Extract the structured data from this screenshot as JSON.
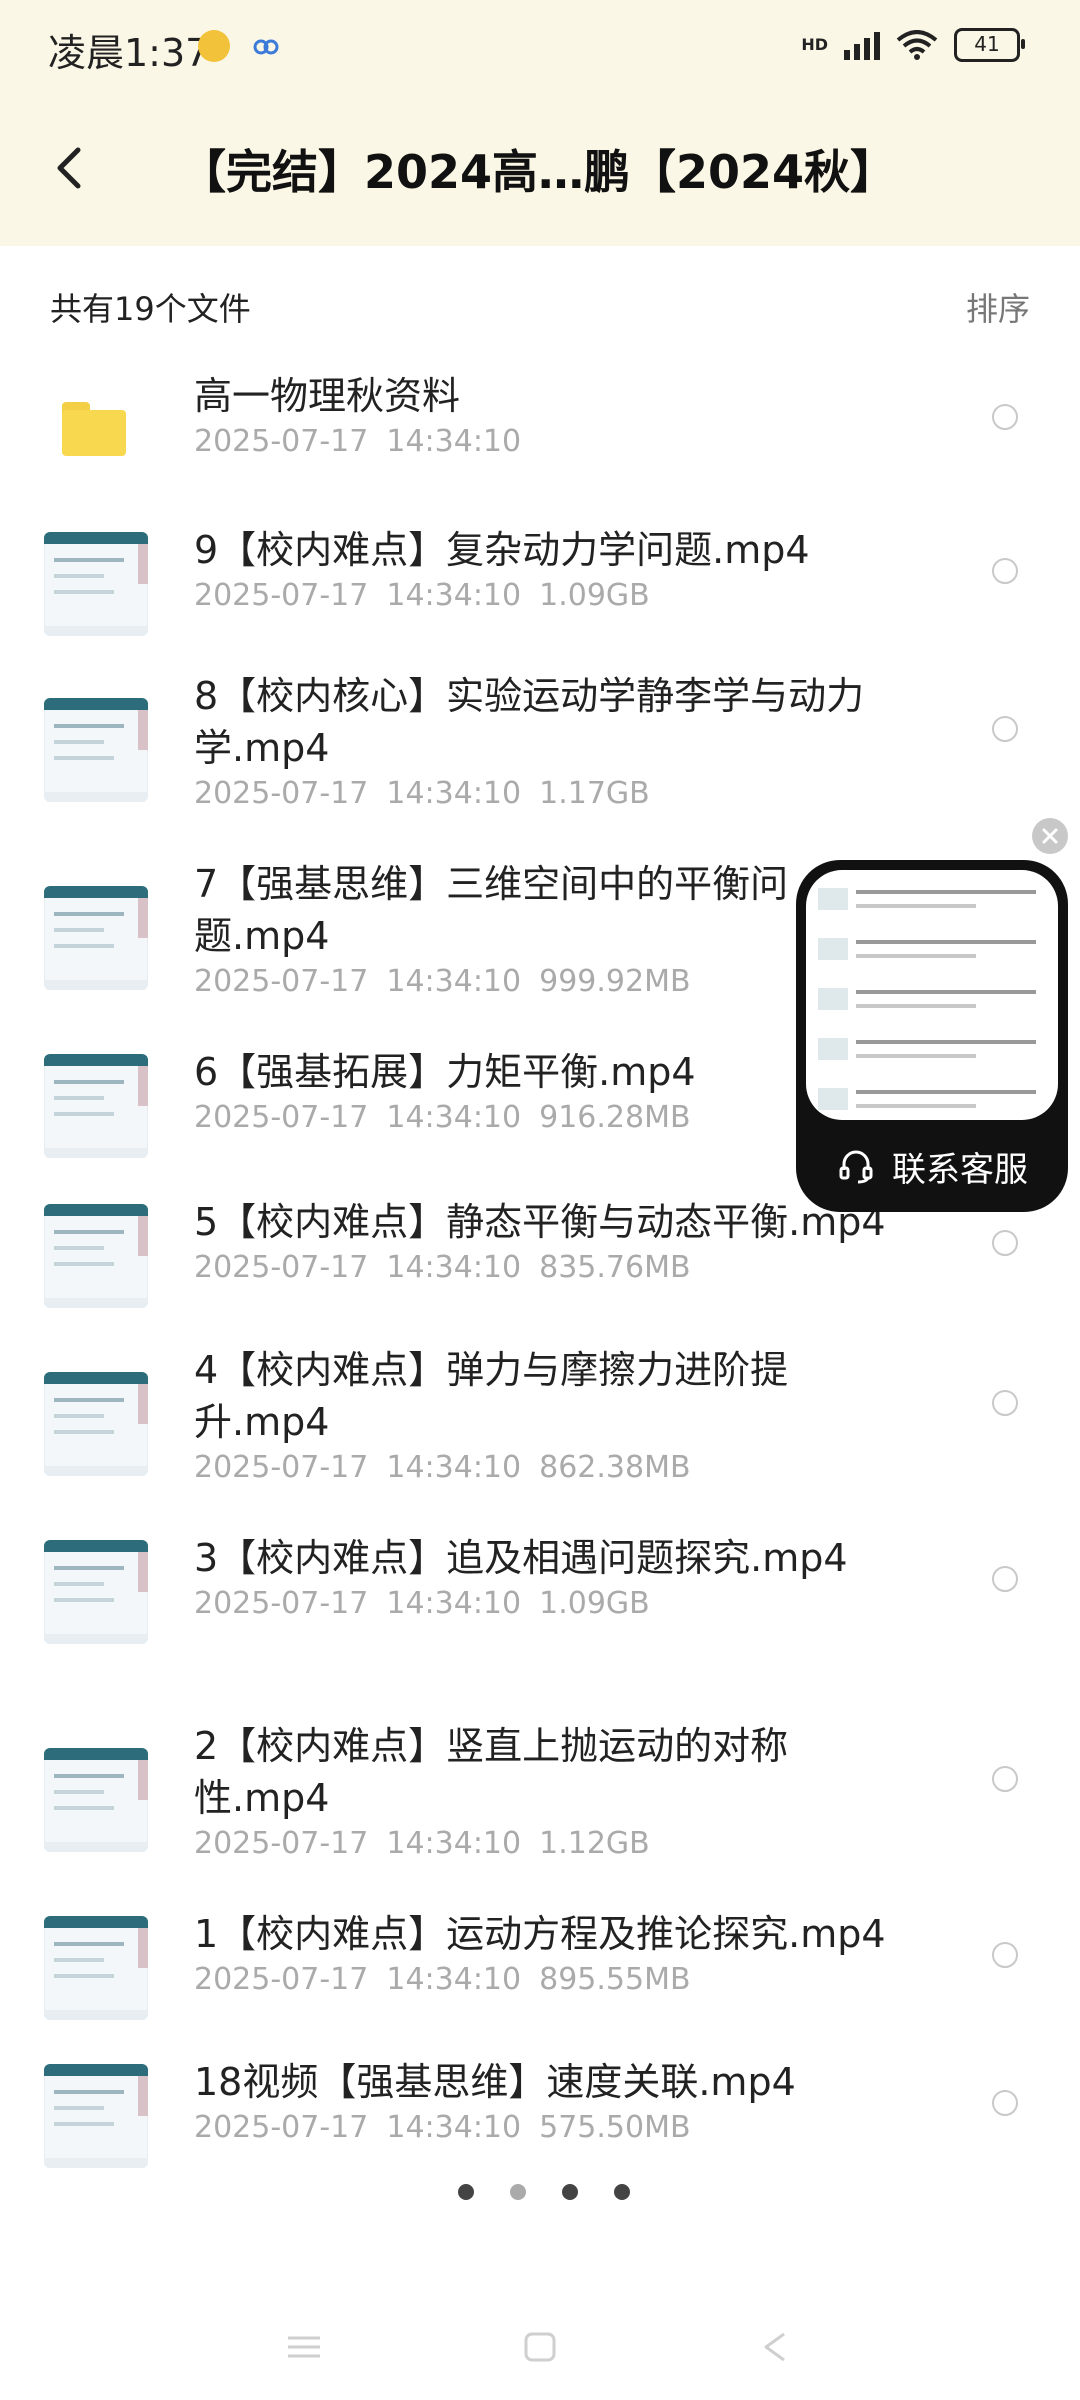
{
  "status": {
    "time": "凌晨1:37",
    "network": "HD",
    "battery": "41",
    "icons": [
      "app-badge-icon",
      "cloud-icon",
      "signal-icon",
      "wifi-icon",
      "battery-icon"
    ]
  },
  "header": {
    "title": "【完结】2024高…鹏【2024秋】",
    "back_icon": "chevron-left-icon"
  },
  "list_header": {
    "summary": "共有19个文件",
    "sort_label": "排序"
  },
  "files": [
    {
      "type": "folder",
      "name_line1": "高一物理秋资料",
      "name_line2": "",
      "date": "2025-07-17",
      "time": "14:34:10",
      "size": ""
    },
    {
      "type": "video",
      "name_line1": "9【校内难点】复杂动力学问题.mp4",
      "name_line2": "",
      "date": "2025-07-17",
      "time": "14:34:10",
      "size": "1.09GB"
    },
    {
      "type": "video",
      "name_line1": "8【校内核心】实验运动学静李学与动力",
      "name_line2": "学.mp4",
      "date": "2025-07-17",
      "time": "14:34:10",
      "size": "1.17GB"
    },
    {
      "type": "video",
      "name_line1": "7【强基思维】三维空间中的平衡问",
      "name_line2": "题.mp4",
      "date": "2025-07-17",
      "time": "14:34:10",
      "size": "999.92MB"
    },
    {
      "type": "video",
      "name_line1": "6【强基拓展】力矩平衡.mp4",
      "name_line2": "",
      "date": "2025-07-17",
      "time": "14:34:10",
      "size": "916.28MB"
    },
    {
      "type": "video",
      "name_line1": "5【校内难点】静态平衡与动态平衡.mp4",
      "name_line2": "",
      "date": "2025-07-17",
      "time": "14:34:10",
      "size": "835.76MB"
    },
    {
      "type": "video",
      "name_line1": "4【校内难点】弹力与摩擦力进阶提",
      "name_line2": "升.mp4",
      "date": "2025-07-17",
      "time": "14:34:10",
      "size": "862.38MB"
    },
    {
      "type": "video",
      "name_line1": "3【校内难点】追及相遇问题探究.mp4",
      "name_line2": "",
      "date": "2025-07-17",
      "time": "14:34:10",
      "size": "1.09GB"
    },
    {
      "type": "video",
      "name_line1": "2【校内难点】竖直上抛运动的对称",
      "name_line2": "性.mp4",
      "date": "2025-07-17",
      "time": "14:34:10",
      "size": "1.12GB"
    },
    {
      "type": "video",
      "name_line1": "1【校内难点】运动方程及推论探究.mp4",
      "name_line2": "",
      "date": "2025-07-17",
      "time": "14:34:10",
      "size": "895.55MB"
    },
    {
      "type": "video",
      "name_line1": "18视频【强基思维】速度关联.mp4",
      "name_line2": "",
      "date": "2025-07-17",
      "time": "14:34:10",
      "size": "575.50MB"
    }
  ],
  "floating_card": {
    "contact_label": "联系客服",
    "icon": "headset-icon",
    "close_icon": "close-icon"
  },
  "pagination": {
    "pages": 4,
    "active": 1
  },
  "navbar": {
    "icons": [
      "menu-icon",
      "home-square-icon",
      "back-triangle-icon"
    ]
  }
}
